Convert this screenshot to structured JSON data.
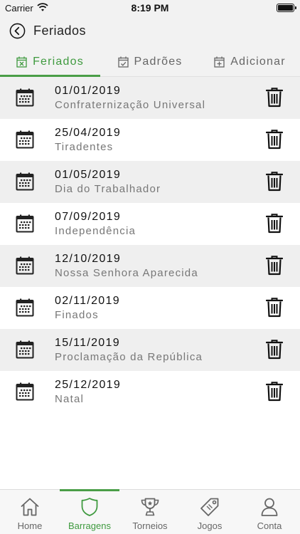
{
  "status_bar": {
    "carrier": "Carrier",
    "time": "8:19 PM"
  },
  "header": {
    "title": "Feriados"
  },
  "tabs": [
    {
      "label": "Feriados",
      "icon": "calendar-x-icon",
      "active": true
    },
    {
      "label": "Padrões",
      "icon": "calendar-check-icon",
      "active": false
    },
    {
      "label": "Adicionar",
      "icon": "calendar-plus-icon",
      "active": false
    }
  ],
  "holidays": [
    {
      "date": "01/01/2019",
      "name": "Confraternização Universal"
    },
    {
      "date": "25/04/2019",
      "name": "Tiradentes"
    },
    {
      "date": "01/05/2019",
      "name": "Dia do Trabalhador"
    },
    {
      "date": "07/09/2019",
      "name": "Independência"
    },
    {
      "date": "12/10/2019",
      "name": "Nossa Senhora Aparecida"
    },
    {
      "date": "02/11/2019",
      "name": "Finados"
    },
    {
      "date": "15/11/2019",
      "name": "Proclamação da República"
    },
    {
      "date": "25/12/2019",
      "name": "Natal"
    }
  ],
  "bottom_nav": [
    {
      "label": "Home",
      "icon": "home-icon",
      "active": false
    },
    {
      "label": "Barragens",
      "icon": "shield-icon",
      "active": true
    },
    {
      "label": "Torneios",
      "icon": "trophy-icon",
      "active": false
    },
    {
      "label": "Jogos",
      "icon": "tag-icon",
      "active": false
    },
    {
      "label": "Conta",
      "icon": "user-icon",
      "active": false
    }
  ],
  "colors": {
    "accent": "#4a9e47",
    "row_alt": "#efefef",
    "bar_bg": "#f2f2f2"
  }
}
